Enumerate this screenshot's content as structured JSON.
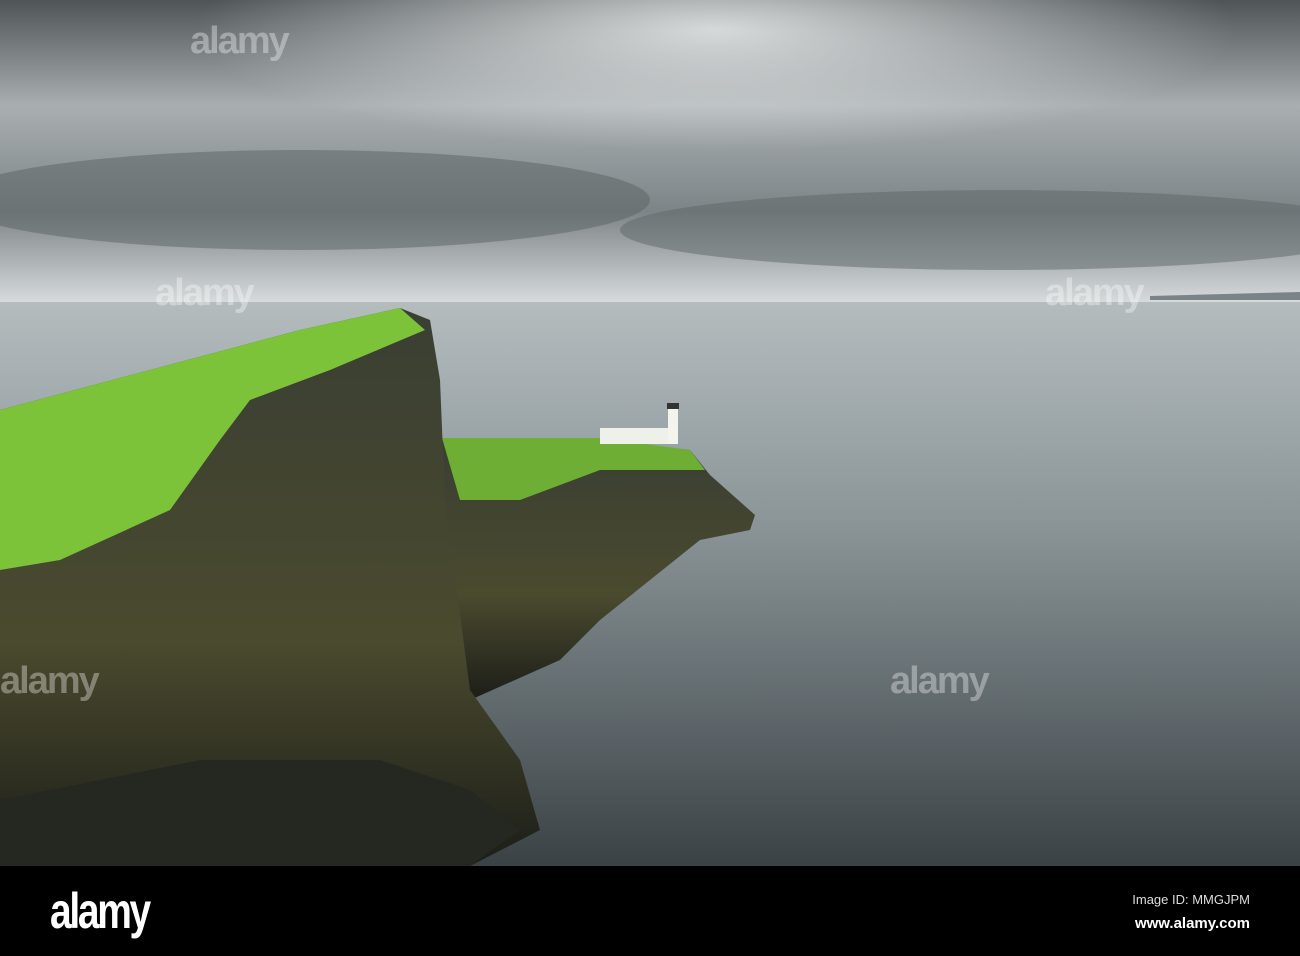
{
  "photo": {
    "subject": "Neist Point lighthouse on sea cliffs under overcast sky",
    "colors": {
      "sky_top": "#5d6466",
      "sky_mid": "#c9ced0",
      "sea": "#8f9a9c",
      "sea_dark": "#3f474b",
      "grass": "#7fc23a",
      "cliff": "#2e3226"
    }
  },
  "watermark": {
    "text": "alamy"
  },
  "footer": {
    "logo": "alamy",
    "image_id": "Image ID: MMGJPM",
    "website": "www.alamy.com"
  }
}
